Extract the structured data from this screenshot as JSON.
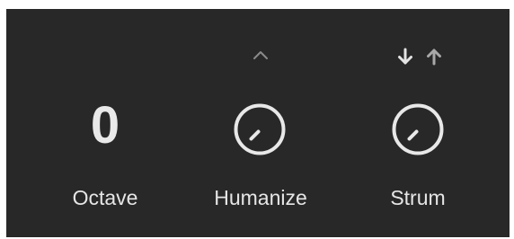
{
  "octave": {
    "value": "0",
    "label": "Octave"
  },
  "humanize": {
    "label": "Humanize",
    "indicator_icon": "chevron-up-icon"
  },
  "strum": {
    "label": "Strum",
    "direction_icons": [
      "arrow-down-icon",
      "arrow-up-icon"
    ]
  },
  "colors": {
    "panel_background": "#282828",
    "text": "#e8e8e8",
    "knob_stroke": "#e8e8e8",
    "dim_icon": "#8a8a8a"
  }
}
